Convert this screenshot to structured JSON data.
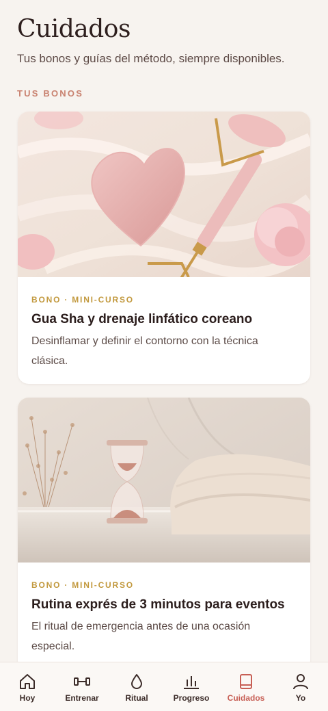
{
  "header": {
    "title": "Cuidados",
    "subtitle": "Tus bonos y guías del método, siempre disponibles."
  },
  "section": {
    "label": "TUS BONOS"
  },
  "cards": [
    {
      "tag": "BONO · MINI-CURSO",
      "title": "Gua Sha y drenaje linfático coreano",
      "description": "Desinflamar y definir el contorno con la técnica clásica."
    },
    {
      "tag": "BONO · MINI-CURSO",
      "title": "Rutina exprés de 3 minutos para eventos",
      "description": "El ritual de emergencia antes de una ocasión especial."
    }
  ],
  "tabbar": {
    "active": "Cuidados",
    "accent_color": "#c75f55",
    "items": [
      {
        "label": "Hoy",
        "icon": "home-icon"
      },
      {
        "label": "Entrenar",
        "icon": "dumbbell-icon"
      },
      {
        "label": "Ritual",
        "icon": "drop-icon"
      },
      {
        "label": "Progreso",
        "icon": "bar-chart-icon"
      },
      {
        "label": "Cuidados",
        "icon": "book-icon"
      },
      {
        "label": "Yo",
        "icon": "user-icon"
      }
    ]
  }
}
